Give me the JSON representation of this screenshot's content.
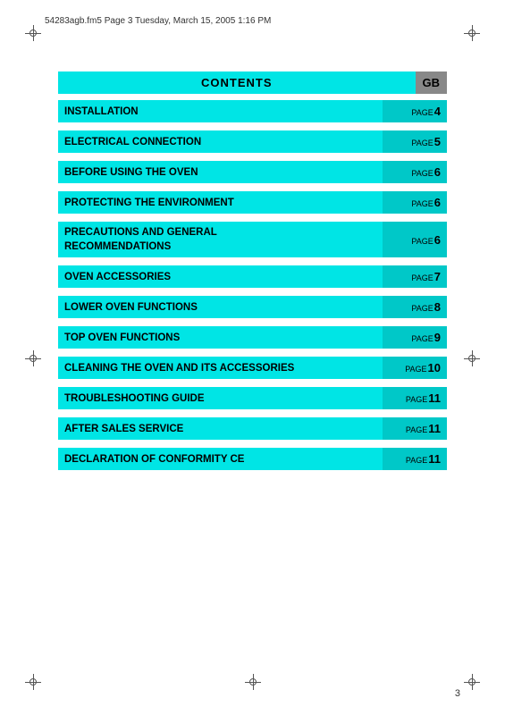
{
  "header": {
    "file_info": "54283agb.fm5  Page 3  Tuesday, March 15, 2005  1:16 PM"
  },
  "contents_title": "CONTENTS",
  "contents_gb": "GB",
  "page_number": "3",
  "toc_items": [
    {
      "title": "INSTALLATION",
      "page": "4",
      "two_line": false
    },
    {
      "title": "ELECTRICAL CONNECTION",
      "page": "5",
      "two_line": false
    },
    {
      "title": "BEFORE USING THE OVEN",
      "page": "6",
      "two_line": false
    },
    {
      "title": "PROTECTING THE ENVIRONMENT",
      "page": "6",
      "two_line": false
    },
    {
      "title": "PRECAUTIONS AND GENERAL\nRECOMMENDATIONS",
      "page": "6",
      "two_line": true
    },
    {
      "title": "OVEN ACCESSORIES",
      "page": "7",
      "two_line": false
    },
    {
      "title": "LOWER OVEN FUNCTIONS",
      "page": "8",
      "two_line": false
    },
    {
      "title": "TOP OVEN FUNCTIONS",
      "page": "9",
      "two_line": false
    },
    {
      "title": "CLEANING THE OVEN AND ITS ACCESSORIES",
      "page": "10",
      "two_line": false
    },
    {
      "title": "TROUBLESHOOTING GUIDE",
      "page": "11",
      "two_line": false
    },
    {
      "title": "AFTER SALES SERVICE",
      "page": "11",
      "two_line": false
    },
    {
      "title": "DECLARATION OF CONFORMITY CE",
      "page": "11",
      "two_line": false
    }
  ]
}
